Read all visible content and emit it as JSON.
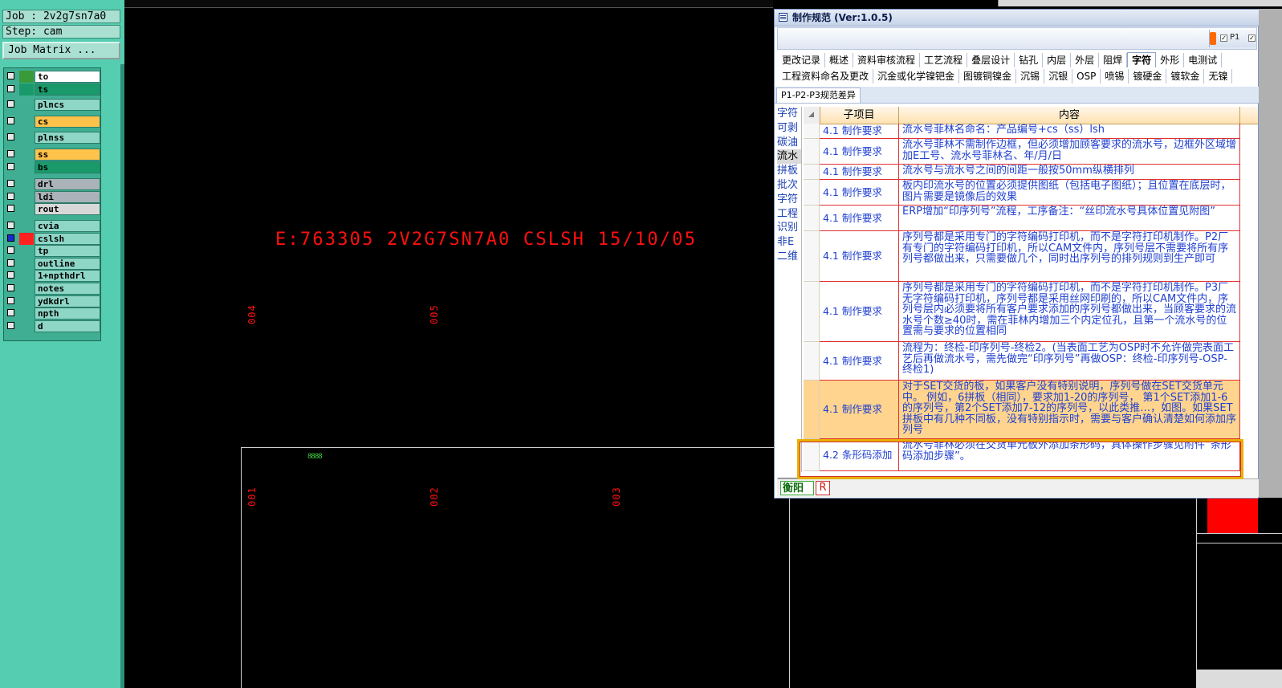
{
  "colors": {
    "canvas_bg": "#000000",
    "left_panel_bg": "#55cdb0",
    "red_text": "#ff1010",
    "grid_link_text": "#1f3fd0",
    "highlight_row": "#ffd48e",
    "highlight_border": "#e8b000"
  },
  "left_panel": {
    "job": "Job : 2v2g7sn7a0",
    "step": "Step: cam",
    "job_matrix_button": "Job Matrix ...",
    "layers": [
      {
        "name": "to",
        "swatch": "#3a9a3a",
        "fill": "#ffffff"
      },
      {
        "name": "ts",
        "swatch": "#1a9a6a",
        "fill": "#1a9a6a"
      },
      {
        "name": "plncs",
        "swatch": "",
        "fill": "#8ed6c6"
      },
      {
        "name": "cs",
        "swatch": "",
        "fill": "#ffc24a"
      },
      {
        "name": "plnss",
        "swatch": "",
        "fill": "#8ed6c6"
      },
      {
        "name": "ss",
        "swatch": "",
        "fill": "#ffc24a"
      },
      {
        "name": "bs",
        "swatch": "",
        "fill": "#1a9a6a"
      },
      {
        "name": "drl",
        "swatch": "",
        "fill": "#a9b3b9"
      },
      {
        "name": "ldi",
        "swatch": "",
        "fill": "#a9b3b9"
      },
      {
        "name": "rout",
        "swatch": "",
        "fill": "#d8d8d8"
      },
      {
        "name": "cvia",
        "swatch": "",
        "fill": "#8ed6c6"
      },
      {
        "name": "cslsh",
        "swatch": "#ff2020",
        "fill": "#8ed6c6"
      },
      {
        "name": "tp",
        "swatch": "",
        "fill": "#8ed6c6"
      },
      {
        "name": "outline",
        "swatch": "",
        "fill": "#8ed6c6"
      },
      {
        "name": "1+npthdrl",
        "swatch": "",
        "fill": "#8ed6c6"
      },
      {
        "name": "notes",
        "swatch": "",
        "fill": "#8ed6c6"
      },
      {
        "name": "ydkdrl",
        "swatch": "",
        "fill": "#8ed6c6"
      },
      {
        "name": "npth",
        "swatch": "",
        "fill": "#8ed6c6"
      },
      {
        "name": "d",
        "swatch": "",
        "fill": "#8ed6c6"
      }
    ]
  },
  "canvas": {
    "serial_text": "E:763305 2V2G7SN7A0 CSLSH 15/10/05",
    "upper_labels": [
      "004",
      "005"
    ],
    "lower_labels": [
      "001",
      "002",
      "003"
    ],
    "green_mark": "8888"
  },
  "dialog": {
    "title": "制作规范 (Ver:1.0.5)",
    "toolbar_p1": "P1",
    "tabs_row1": [
      "更改记录",
      "概述",
      "资料审核流程",
      "工艺流程",
      "叠层设计",
      "钻孔",
      "内层",
      "外层",
      "阻焊",
      "字符",
      "外形",
      "电测试"
    ],
    "selected_tab": "字符",
    "tabs_row2": [
      "工程资料命名及更改",
      "沉金或化学镍钯金",
      "图镀铜镍金",
      "沉锡",
      "沉银",
      "OSP",
      "喷锡",
      "镀硬金",
      "镀软金",
      "无镍"
    ],
    "tabs_row3": [
      "P1-P2-P3规范差异"
    ],
    "left_items": [
      "字符",
      "可剥",
      "碳油",
      "流水",
      "拼板",
      "批次",
      "字符",
      "工程",
      "识别",
      "非E",
      "二维"
    ],
    "selected_left_item": "流水",
    "columns": [
      "子项目",
      "内容"
    ],
    "rows": [
      {
        "sub": "4.1 制作要求",
        "content": "流水号菲林名命名：产品编号+cs（ss）lsh"
      },
      {
        "sub": "4.1 制作要求",
        "content": "流水号菲林不需制作边框，但必须增加顾客要求的流水号，边框外区域增加E工号、流水号菲林名、年/月/日"
      },
      {
        "sub": "4.1 制作要求",
        "content": "流水号与流水号之间的间距一般按50mm纵横排列"
      },
      {
        "sub": "4.1 制作要求",
        "content": "板内印流水号的位置必须提供图纸（包括电子图纸）；且位置在底层时，图片需要是镜像后的效果"
      },
      {
        "sub": "4.1 制作要求",
        "content": "ERP增加“印序列号”流程，工序备注：“丝印流水号具体位置见附图”"
      },
      {
        "sub": "4.1 制作要求",
        "content": "序列号都是采用专门的字符编码打印机，而不是字符打印机制作。P2厂有专门的字符编码打印机，所以CAM文件内，序列号层不需要将所有序列号都做出来，只需要做几个，同时出序列号的排列规则到生产即可"
      },
      {
        "sub": "4.1 制作要求",
        "content": "序列号都是采用专门的字符编码打印机，而不是字符打印机制作。P3厂无字符编码打印机，序列号都是采用丝网印刷的，所以CAM文件内，序列号层内必须要将所有客户要求添加的序列号都做出来，当顾客要求的流水号个数≥40时，需在菲林内增加三个内定位孔，且第一个流水号的位置需与要求的位置相同"
      },
      {
        "sub": "4.1 制作要求",
        "content": "流程为：终检-印序列号-终检2。(当表面工艺为OSP时不允许做完表面工艺后再做流水号，需先做完“印序列号”再做OSP：终检-印序列号-OSP-终检1)"
      },
      {
        "sub": "4.1 制作要求",
        "content": "对于SET交货的板，如果客户没有特别说明，序列号做在SET交货单元中。 例如，6拼板（相同），要求加1-20的序列号， 第1个SET添加1-6的序列号，第2个SET添加7-12的序列号，以此类推…，如图。如果SET拼板中有几种不同板，没有特别指示时，需要与客户确认清楚如何添加序列号"
      },
      {
        "sub": "4.2 条形码添加",
        "content": "流水号菲林必须在交货单元板外添加条形码，具体操作步骤见附件“条形码添加步骤”。"
      }
    ],
    "status_left": "衡阳",
    "status_right": "R"
  }
}
